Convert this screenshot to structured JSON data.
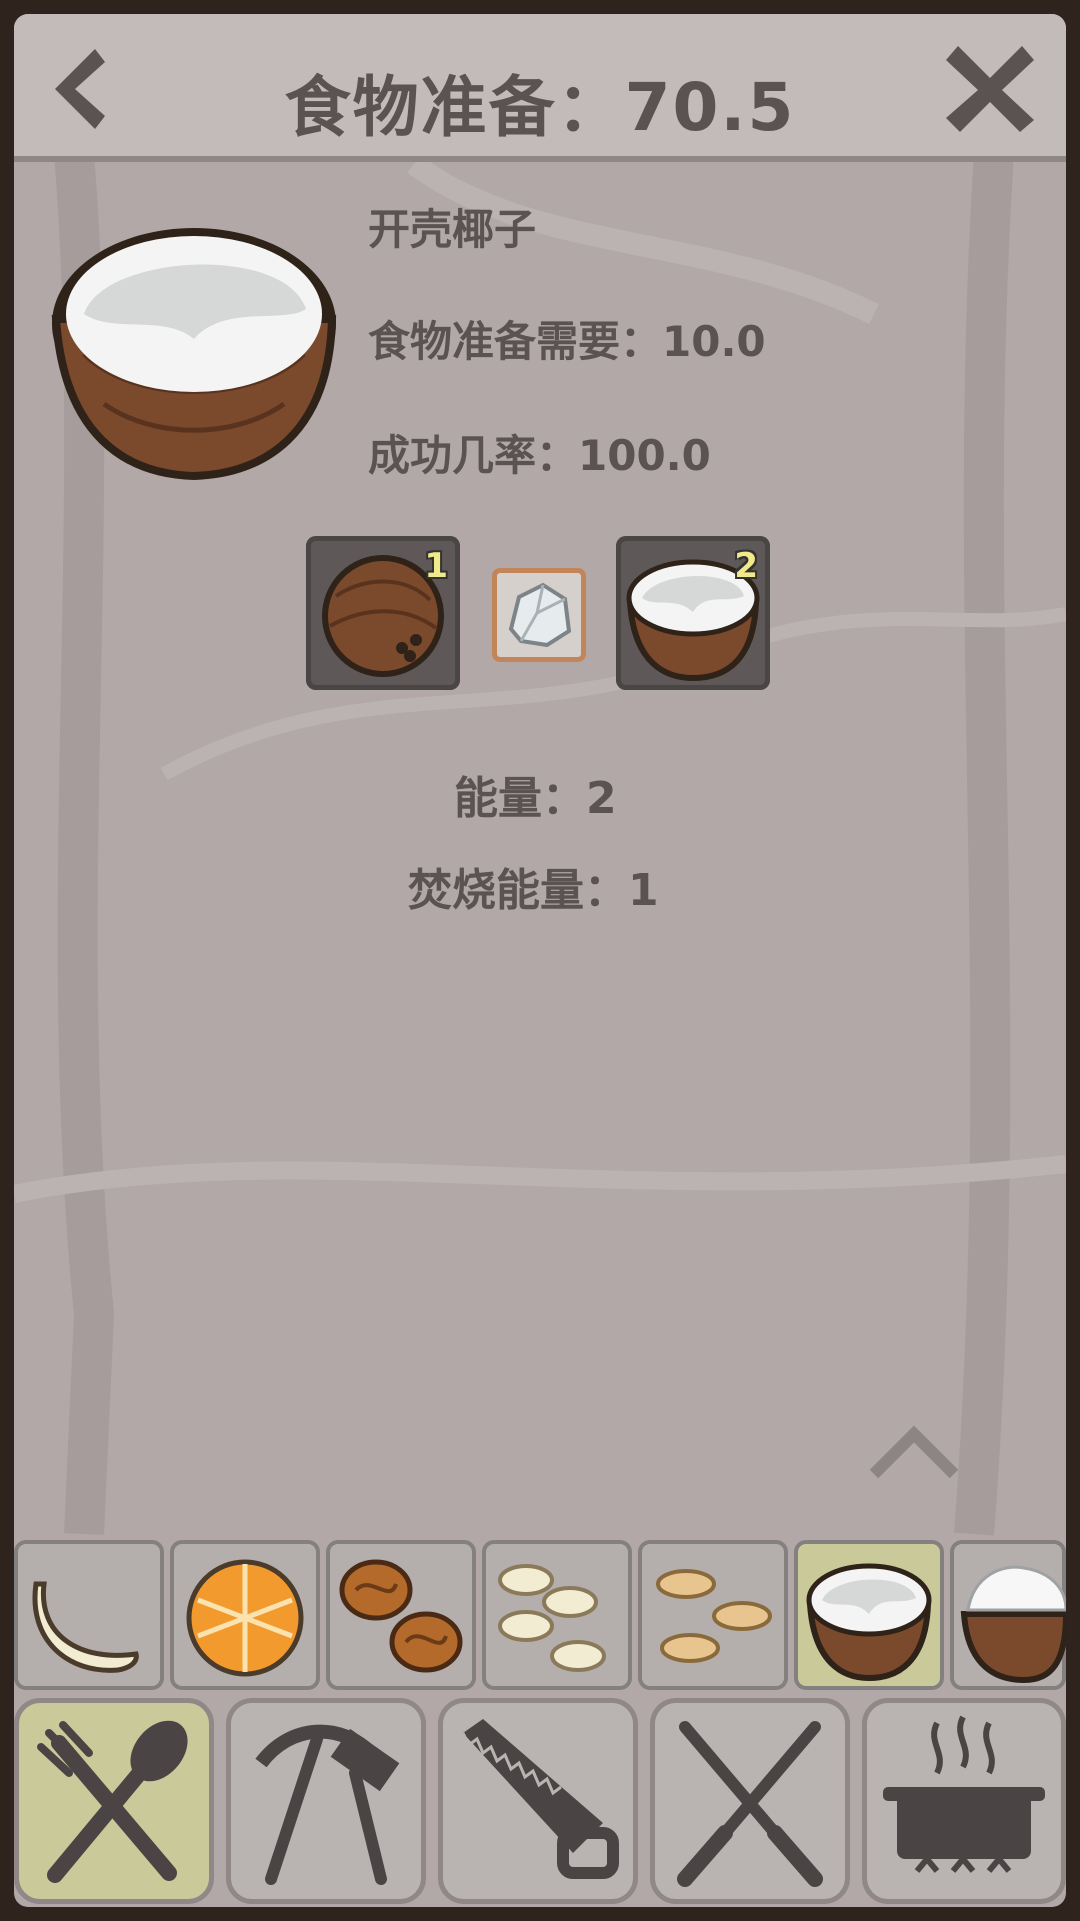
{
  "header": {
    "title": "食物准备：70.5",
    "back_icon": "chevron-left-icon",
    "close_icon": "close-icon"
  },
  "recipe_detail": {
    "name": "开壳椰子",
    "requirement_text": "食物准备需要：10.0",
    "success_text": "成功几率：100.0",
    "input": {
      "icon": "coconut-icon",
      "count": "1"
    },
    "tool": {
      "icon": "stone-icon"
    },
    "output": {
      "icon": "open-coconut-icon",
      "count": "2"
    },
    "energy_text": "能量：2",
    "burn_energy_text": "焚烧能量：1"
  },
  "recipes": [
    {
      "icon": "banana-icon",
      "selected": false
    },
    {
      "icon": "orange-icon",
      "selected": false
    },
    {
      "icon": "walnut-icon",
      "selected": false
    },
    {
      "icon": "sliced-banana-icon",
      "selected": false
    },
    {
      "icon": "peanut-icon",
      "selected": false
    },
    {
      "icon": "open-coconut-icon",
      "selected": true
    },
    {
      "icon": "shredded-coconut-icon",
      "selected": false
    }
  ],
  "categories": [
    {
      "icon": "fork-spoon-icon",
      "selected": true
    },
    {
      "icon": "pickaxe-hammer-icon",
      "selected": false
    },
    {
      "icon": "saw-icon",
      "selected": false
    },
    {
      "icon": "knives-icon",
      "selected": false
    },
    {
      "icon": "cooking-pot-icon",
      "selected": false
    }
  ],
  "colors": {
    "panel": "#b1a8a7",
    "header": "#c2bbba",
    "text": "#5a5352",
    "selected": "#c9c99a",
    "count": "#f2e98a"
  }
}
